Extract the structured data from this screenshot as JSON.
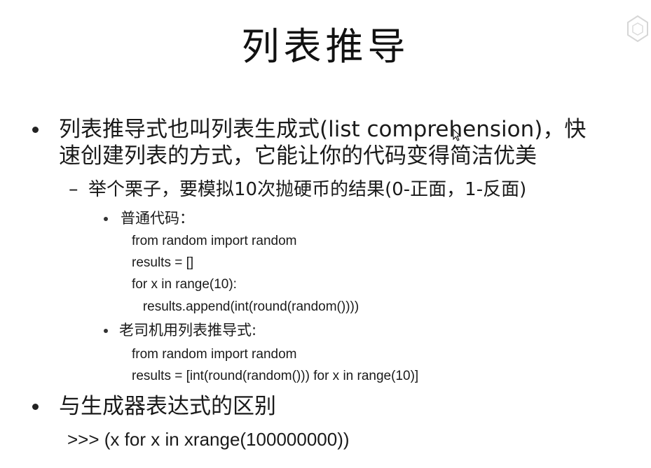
{
  "slide": {
    "title": "列表推导",
    "bullets": [
      {
        "line1": "列表推导式也叫列表生成式(list comprehension)，快",
        "line2": "速创建列表的方式，它能让你的代码变得简洁优美",
        "sub": {
          "text": "举个栗子，要模拟10次抛硬币的结果(0-正面，1-反面)",
          "items": [
            {
              "label": "普通代码：",
              "code": [
                "from random import random",
                "results = []",
                "for x in range(10):",
                "   results.append(int(round(random())))"
              ]
            },
            {
              "label": "老司机用列表推导式:",
              "code": [
                "from random import random",
                "results = [int(round(random())) for x in range(10)]"
              ]
            }
          ]
        }
      },
      {
        "line1": "与生成器表达式的区别",
        "repl": ">>> (x for x in xrange(100000000))"
      }
    ]
  },
  "icons": {
    "watermark": "logo-watermark-icon",
    "cursor": "mouse-cursor-icon"
  },
  "colors": {
    "text": "#1a1a1a",
    "background": "#ffffff"
  }
}
